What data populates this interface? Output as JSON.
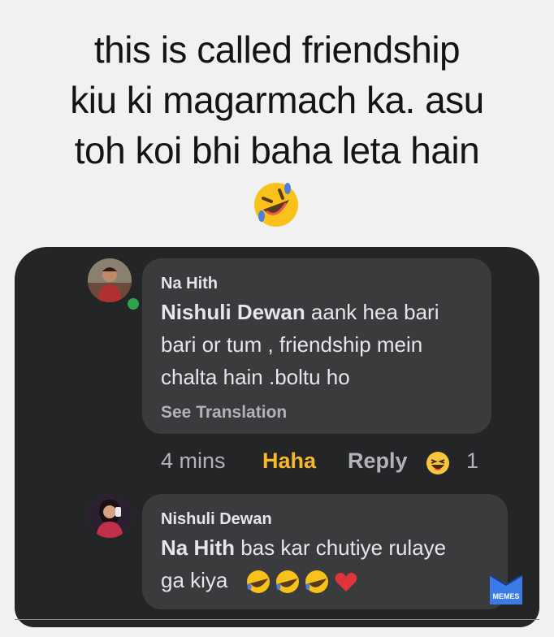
{
  "caption": {
    "lines": [
      "this is called friendship",
      "kiu ki magarmach ka. asu",
      "toh koi bhi baha leta hain"
    ],
    "emoji": "rolling-on-floor-laughing-emoji"
  },
  "comment1": {
    "author": "Na Hith",
    "mention": "Nishuli Dewan",
    "text_line1": " aank hea bari",
    "text_line2": "bari or tum , friendship mein",
    "text_line3": "chalta hain .boltu ho",
    "see_translation": "See Translation",
    "time": "4 mins",
    "reaction_label": "Haha",
    "reply_label": "Reply",
    "reaction_count": "1"
  },
  "comment2": {
    "author": "Nishuli Dewan",
    "mention": "Na Hith",
    "text_line1": " bas kar chutiye rulaye",
    "text_line2": "ga kiya"
  },
  "watermark": {
    "label": "MEMES"
  },
  "colors": {
    "card": "#242526",
    "bubble": "#3a3b3c",
    "text": "#e4e6eb",
    "muted": "#b0b3b8",
    "haha": "#f7b928",
    "online": "#31a24c"
  }
}
